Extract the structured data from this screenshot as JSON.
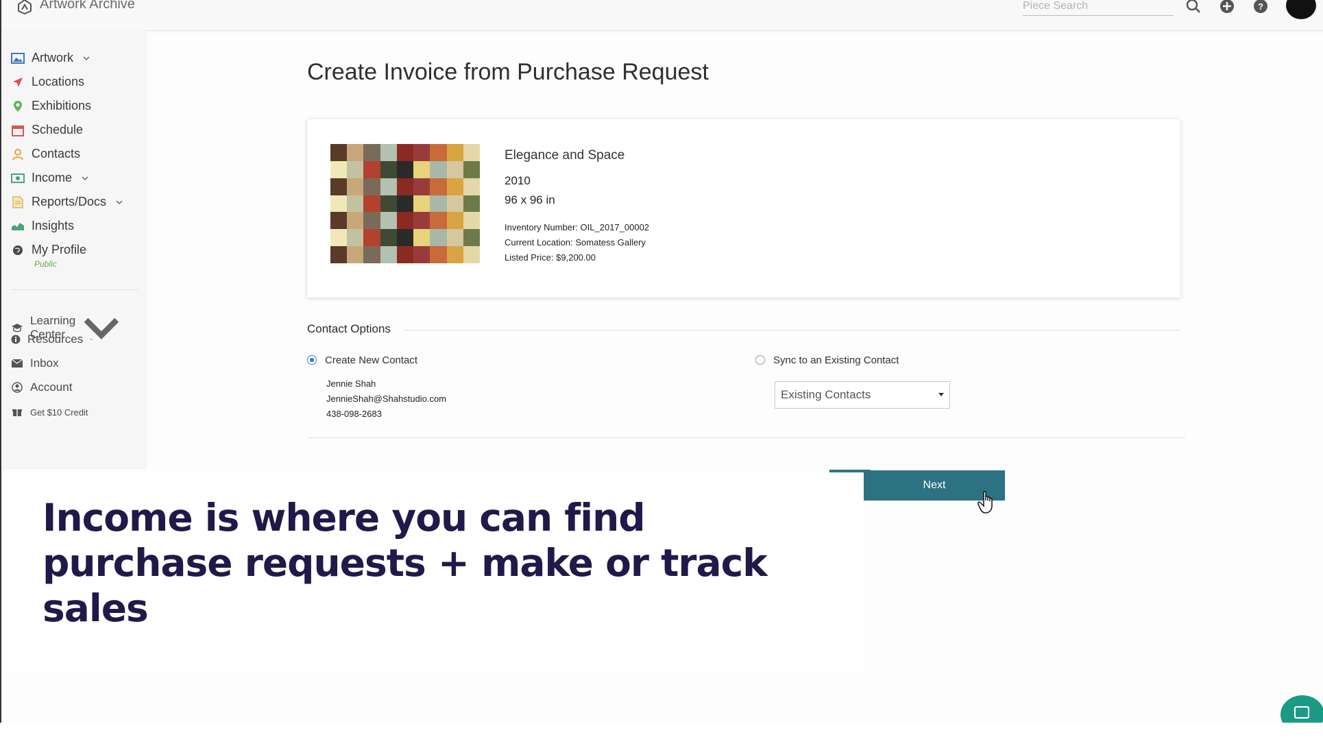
{
  "app": {
    "name": "Artwork Archive",
    "search_placeholder": "Piece Search"
  },
  "sidebar": {
    "items": [
      {
        "label": "Artwork",
        "icon": "image-icon",
        "has_chevron": true
      },
      {
        "label": "Locations",
        "icon": "location-arrow-icon",
        "has_chevron": false
      },
      {
        "label": "Exhibitions",
        "icon": "map-pin-icon",
        "has_chevron": false
      },
      {
        "label": "Schedule",
        "icon": "calendar-icon",
        "has_chevron": false
      },
      {
        "label": "Contacts",
        "icon": "contacts-icon",
        "has_chevron": false
      },
      {
        "label": "Income",
        "icon": "money-icon",
        "has_chevron": true
      },
      {
        "label": "Reports/Docs",
        "icon": "document-icon",
        "has_chevron": true
      },
      {
        "label": "Insights",
        "icon": "chart-icon",
        "has_chevron": false
      },
      {
        "label": "My Profile",
        "icon": "globe-icon",
        "has_chevron": false
      }
    ],
    "profile_sub": "Public",
    "secondary": [
      {
        "label": "Learning Center",
        "icon": "graduation-cap-icon",
        "has_chevron": true
      },
      {
        "label": "Resources",
        "icon": "info-icon",
        "has_chevron": true
      },
      {
        "label": "Inbox",
        "icon": "envelope-icon",
        "has_chevron": false
      },
      {
        "label": "Account",
        "icon": "user-circle-icon",
        "has_chevron": false
      },
      {
        "label": "Get $10 Credit",
        "icon": "gift-icon",
        "has_chevron": false
      }
    ]
  },
  "main": {
    "title": "Create Invoice from Purchase Request",
    "artwork": {
      "title": "Elegance and Space",
      "year": "2010",
      "size": "96 x 96 in",
      "inventory": "Inventory Number: OIL_2017_00002",
      "location": "Current Location: Somatess Gallery",
      "price": "Listed Price: $9,200.00"
    },
    "contact_options": {
      "title": "Contact Options",
      "create_label": "Create New Contact",
      "sync_label": "Sync to an Existing Contact",
      "contact_name": "Jennie Shah",
      "contact_email": "JennieShah@Shahstudio.com",
      "contact_phone": "438-098-2683",
      "existing_select": "Existing Contacts"
    },
    "next_label": "Next"
  },
  "caption": {
    "text": "Income is where you can find purchase requests + make or track  sales"
  },
  "colors": {
    "accent": "#2d7283",
    "caption": "#201a4a",
    "chat": "#1d9a86"
  }
}
